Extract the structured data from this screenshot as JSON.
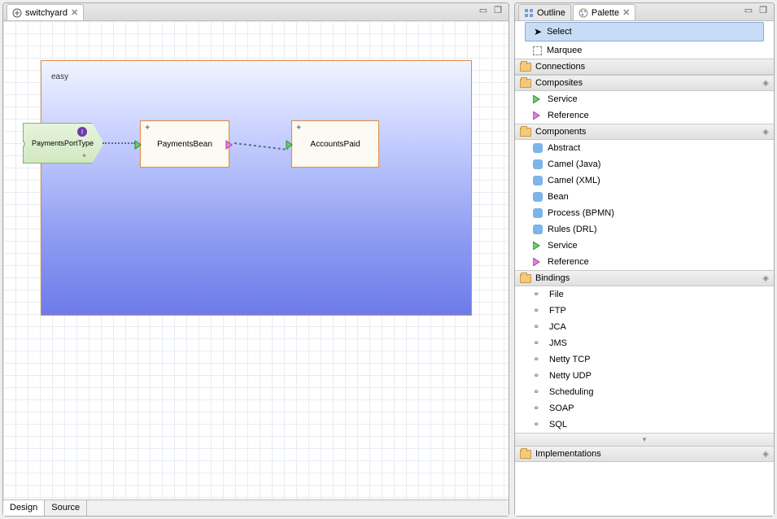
{
  "editor": {
    "tab_label": "switchyard",
    "bottom_tabs": {
      "design": "Design",
      "source": "Source"
    },
    "composite_name": "easy",
    "service_name": "PaymentsPortType",
    "component1_name": "PaymentsBean",
    "component2_name": "AccountsPaid"
  },
  "side_tabs": {
    "outline": "Outline",
    "palette": "Palette"
  },
  "palette": {
    "tools": {
      "select": "Select",
      "marquee": "Marquee"
    },
    "drawers": {
      "connections": "Connections",
      "composites": "Composites",
      "components": "Components",
      "bindings": "Bindings",
      "implementations": "Implementations"
    },
    "composites": {
      "service": "Service",
      "reference": "Reference"
    },
    "components": {
      "abstract": "Abstract",
      "camel_java": "Camel (Java)",
      "camel_xml": "Camel (XML)",
      "bean": "Bean",
      "process_bpmn": "Process (BPMN)",
      "rules_drl": "Rules (DRL)",
      "service": "Service",
      "reference": "Reference"
    },
    "bindings": {
      "file": "File",
      "ftp": "FTP",
      "jca": "JCA",
      "jms": "JMS",
      "netty_tcp": "Netty TCP",
      "netty_udp": "Netty UDP",
      "scheduling": "Scheduling",
      "soap": "SOAP",
      "sql": "SQL"
    }
  }
}
